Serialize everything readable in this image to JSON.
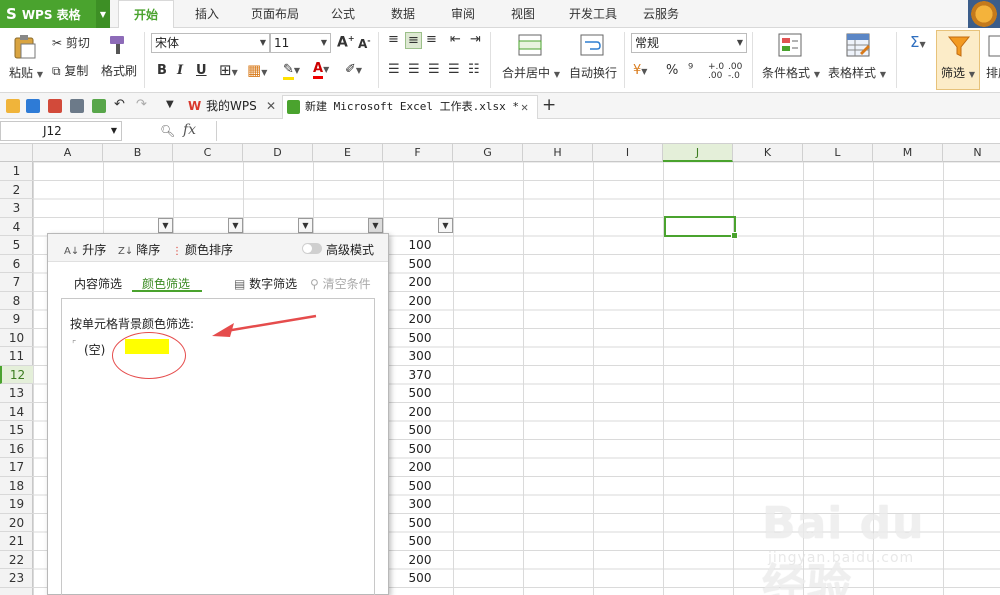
{
  "app": {
    "logo": "S",
    "name": "WPS 表格"
  },
  "menu_tabs": [
    "开始",
    "插入",
    "页面布局",
    "公式",
    "数据",
    "审阅",
    "视图",
    "开发工具",
    "云服务"
  ],
  "ribbon": {
    "paste": "粘贴",
    "cut": "剪切",
    "copy": "复制",
    "format_painter": "格式刷",
    "font_name": "宋体",
    "font_size": "11",
    "merge_center": "合并居中",
    "wrap_text": "自动换行",
    "number_format": "常规",
    "conditional_format": "条件格式",
    "table_style": "表格样式",
    "filter": "筛选",
    "sort": "排序",
    "sum_symbol": "Σ"
  },
  "doc_tabs": [
    {
      "label": "我的WPS",
      "icon": "wps-icon"
    },
    {
      "label": "新建 Microsoft Excel 工作表.xlsx *",
      "icon": "excel-file-icon"
    }
  ],
  "formula_bar": {
    "name_box": "J12",
    "fx": "fx"
  },
  "columns": [
    "A",
    "B",
    "C",
    "D",
    "E",
    "F",
    "G",
    "H",
    "I",
    "J",
    "K",
    "L",
    "M",
    "N"
  ],
  "selected_column": "J",
  "rows": [
    "1",
    "2",
    "3",
    "4",
    "5",
    "6",
    "7",
    "8",
    "9",
    "10",
    "11",
    "12",
    "13",
    "14",
    "15",
    "16",
    "17",
    "18",
    "19",
    "20",
    "21",
    "22",
    "23"
  ],
  "selected_row": "12",
  "column_f_values": [
    "100",
    "500",
    "200",
    "200",
    "200",
    "500",
    "300",
    "370",
    "500",
    "200",
    "500",
    "500",
    "200",
    "500",
    "300",
    "500",
    "500",
    "200",
    "500"
  ],
  "filter_panel": {
    "sort_asc": "升序",
    "sort_desc": "降序",
    "color_sort": "颜色排序",
    "advanced_mode": "高级模式",
    "tab_content": "内容筛选",
    "tab_color": "颜色筛选",
    "number_filter": "数字筛选",
    "clear_conditions": "清空条件",
    "body_title": "按单元格背景颜色筛选:",
    "empty_option": "(空)",
    "swatch_color": "#ffff00"
  },
  "watermark": {
    "main": "Bai du 经验",
    "sub": "jingyan.baidu.com"
  },
  "colors": {
    "accent": "#4aa32e",
    "annotation": "#e54c4c"
  }
}
